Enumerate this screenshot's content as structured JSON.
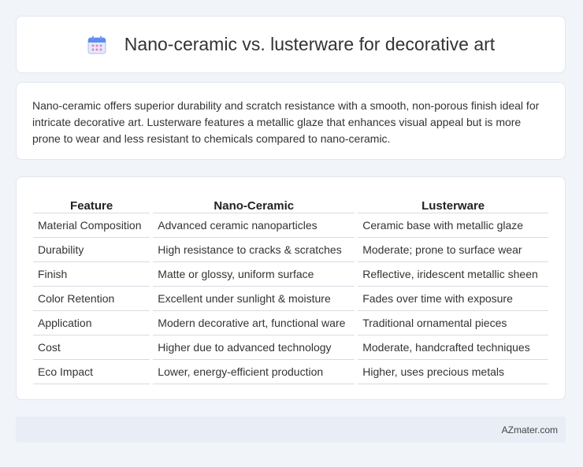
{
  "header": {
    "title": "Nano-ceramic vs. lusterware for decorative art",
    "icon": "calendar-icon"
  },
  "summary": {
    "text": "Nano-ceramic offers superior durability and scratch resistance with a smooth, non-porous finish ideal for intricate decorative art. Lusterware features a metallic glaze that enhances visual appeal but is more prone to wear and less resistant to chemicals compared to nano-ceramic."
  },
  "table": {
    "columns": [
      "Feature",
      "Nano-Ceramic",
      "Lusterware"
    ],
    "rows": [
      [
        "Material Composition",
        "Advanced ceramic nanoparticles",
        "Ceramic base with metallic glaze"
      ],
      [
        "Durability",
        "High resistance to cracks & scratches",
        "Moderate; prone to surface wear"
      ],
      [
        "Finish",
        "Matte or glossy, uniform surface",
        "Reflective, iridescent metallic sheen"
      ],
      [
        "Color Retention",
        "Excellent under sunlight & moisture",
        "Fades over time with exposure"
      ],
      [
        "Application",
        "Modern decorative art, functional ware",
        "Traditional ornamental pieces"
      ],
      [
        "Cost",
        "Higher due to advanced technology",
        "Moderate, handcrafted techniques"
      ],
      [
        "Eco Impact",
        "Lower, energy-efficient production",
        "Higher, uses precious metals"
      ]
    ]
  },
  "footer": {
    "site": "AZmater.com"
  },
  "colors": {
    "background": "#f1f4f9",
    "card": "#ffffff",
    "footer": "#e8edf6",
    "icon_blue": "#5b8def",
    "icon_pink": "#e882b8"
  }
}
